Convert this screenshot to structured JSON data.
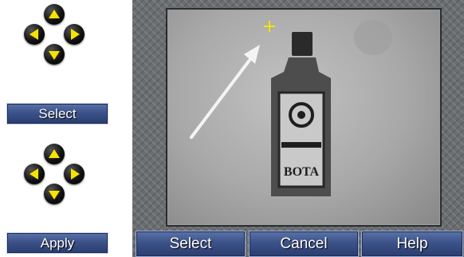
{
  "left_panel": {
    "select_label": "Select",
    "apply_label": "Apply"
  },
  "viewport": {
    "bottle_label_text": "BOTA"
  },
  "bottom_bar": {
    "select_label": "Select",
    "cancel_label": "Cancel",
    "help_label": "Help"
  },
  "colors": {
    "arrow_glyph": "#f7e300",
    "crosshair": "#f2e400",
    "button_fill": "#3c5289",
    "button_border": "#c8d3ea"
  }
}
